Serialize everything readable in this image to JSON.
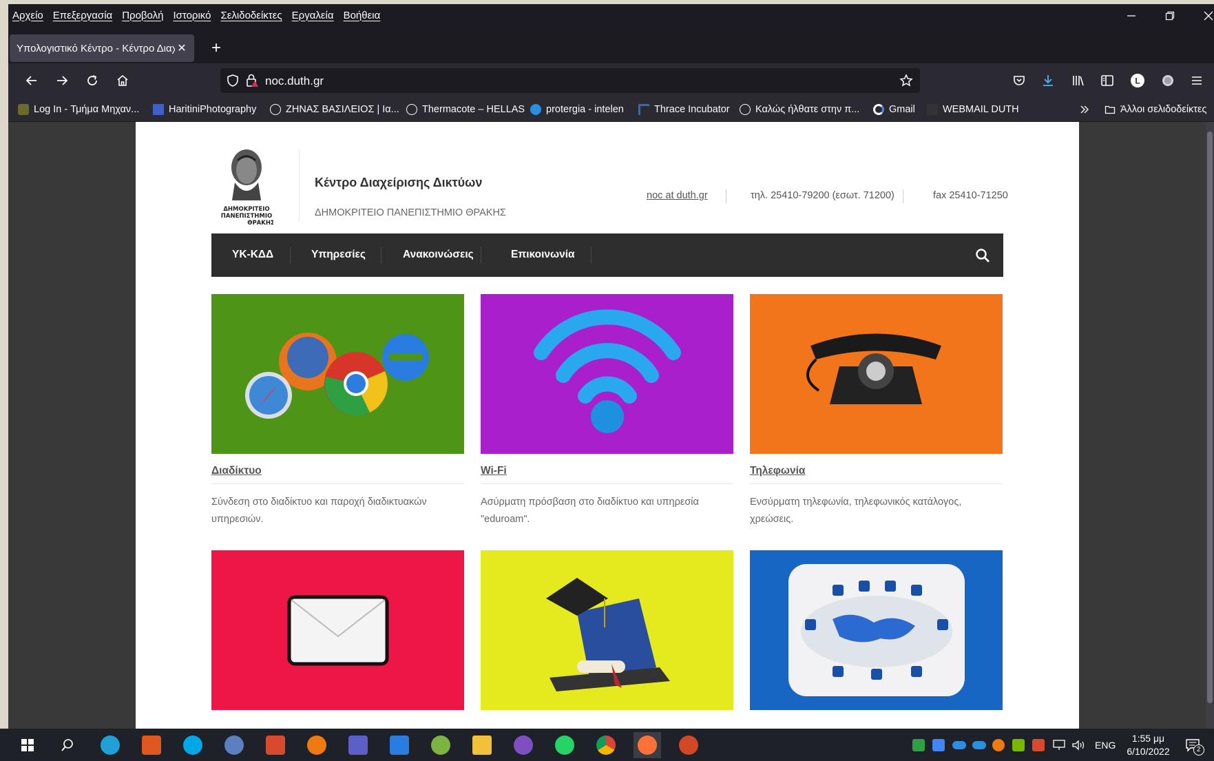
{
  "menu": [
    "Αρχείο",
    "Επεξεργασία",
    "Προβολή",
    "Ιστορικό",
    "Σελιδοδείκτες",
    "Εργαλεία",
    "Βοήθεια"
  ],
  "tab": {
    "title": "Υπολογιστικό Κέντρο - Κέντρο Διαχ",
    "close": "✕",
    "new": "+"
  },
  "url": "noc.duth.gr",
  "bookmarks": [
    {
      "label": "Log In - Τμήμα Μηχαν...",
      "color": "#6b6b2f"
    },
    {
      "label": "HaritiniPhotography",
      "color": "#3f5fd0"
    },
    {
      "label": "ΖΗΝΑΣ ΒΑΣΙΛΕΙΟΣ | Ια...",
      "color": "#ffffff"
    },
    {
      "label": "Thermacote – HELLAS",
      "color": "#ffffff"
    },
    {
      "label": "protergia - intelen",
      "color": "#2a8fe0"
    },
    {
      "label": "Thrace Incubator",
      "color": "#2a6cc0"
    },
    {
      "label": "Καλώς ήλθατε στην π...",
      "color": "#ffffff"
    },
    {
      "label": "Gmail",
      "color": "#ffffff"
    },
    {
      "label": "WEBMAIL DUTH",
      "color": "#333333"
    }
  ],
  "bookmarks_overflow": "Άλλοι σελιδοδείκτες",
  "site": {
    "title": "Κέντρο Διαχείρισης Δικτύων",
    "subtitle": "ΔΗΜΟΚΡΙΤΕΙΟ ΠΑΝΕΠΙΣΤΗΜΙΟ ΘΡΑΚΗΣ",
    "logo_lines": [
      "ΔΗΜΟΚΡΙΤΕΙΟ",
      "ΠΑΝΕΠΙΣΤΗΜΙΟ",
      "ΘΡΑΚΗΣ"
    ],
    "email": "noc at duth.gr",
    "phone": "τηλ. 25410-79200 (εσωτ. 71200)",
    "fax": "fax 25410-71250"
  },
  "nav": [
    "ΥΚ-ΚΔΔ",
    "Υπηρεσίες",
    "Ανακοινώσεις",
    "Επικοινωνία"
  ],
  "cards": [
    {
      "title": "Διαδίκτυο",
      "desc": "Σύνδεση στο διαδίκτυο και παροχή διαδικτυακών υπηρεσιών.",
      "bg": "#4e9416"
    },
    {
      "title": "Wi-Fi",
      "desc": "Ασύρματη πρόσβαση στο διαδίκτυο και υπηρεσία \"eduroam\".",
      "bg": "#a91fcc"
    },
    {
      "title": "Τηλεφωνία",
      "desc": "Ενσύρματη τηλεφωνία, τηλεφωνικός κατάλογος, χρεώσεις.",
      "bg": "#f2741b"
    },
    {
      "title": "",
      "desc": "",
      "bg": "#ee1547"
    },
    {
      "title": "",
      "desc": "",
      "bg": "#e5ea1f"
    },
    {
      "title": "",
      "desc": "",
      "bg": "#1766c4"
    }
  ],
  "taskbar": {
    "lang": "ENG",
    "time": "1:55 μμ",
    "date": "6/10/2022",
    "notif": "2"
  }
}
